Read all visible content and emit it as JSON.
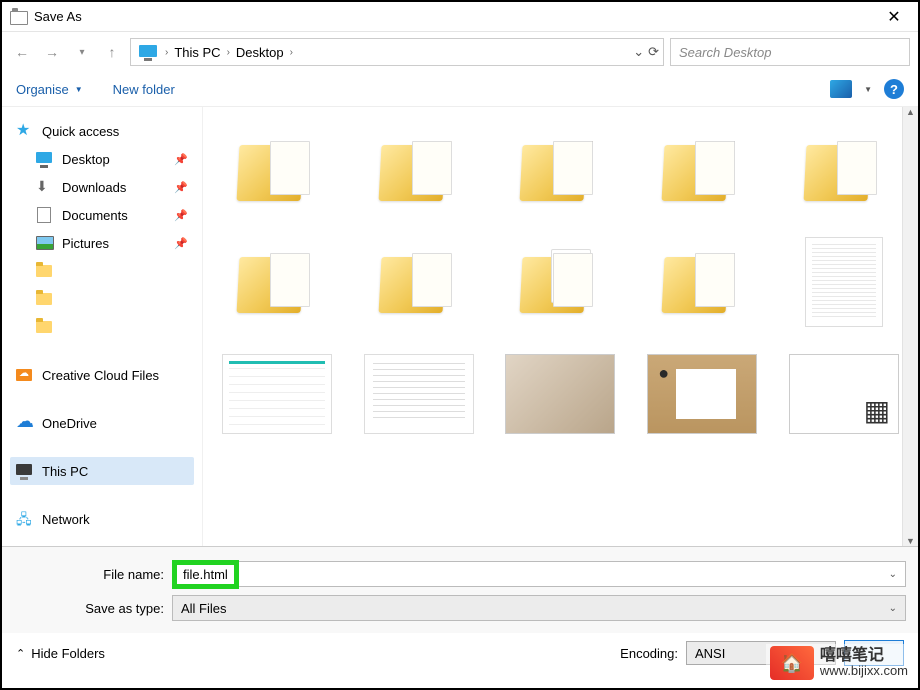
{
  "window": {
    "title": "Save As"
  },
  "nav": {
    "breadcrumb": [
      "This PC",
      "Desktop"
    ],
    "search_placeholder": "Search Desktop"
  },
  "toolbar": {
    "organise": "Organise",
    "new_folder": "New folder"
  },
  "sidebar": {
    "quick_access": "Quick access",
    "desktop": "Desktop",
    "downloads": "Downloads",
    "documents": "Documents",
    "pictures": "Pictures",
    "creative_cloud": "Creative Cloud Files",
    "onedrive": "OneDrive",
    "this_pc": "This PC",
    "network": "Network"
  },
  "form": {
    "file_name_label": "File name:",
    "file_name_value": "file.html",
    "save_type_label": "Save as type:",
    "save_type_value": "All Files",
    "encoding_label": "Encoding:",
    "encoding_value": "ANSI",
    "hide_folders": "Hide Folders"
  },
  "watermark": {
    "line1": "嘻嘻笔记",
    "line2": "www.bijixx.com"
  },
  "colors": {
    "accent": "#1e7dd6",
    "highlight": "#21d321"
  }
}
